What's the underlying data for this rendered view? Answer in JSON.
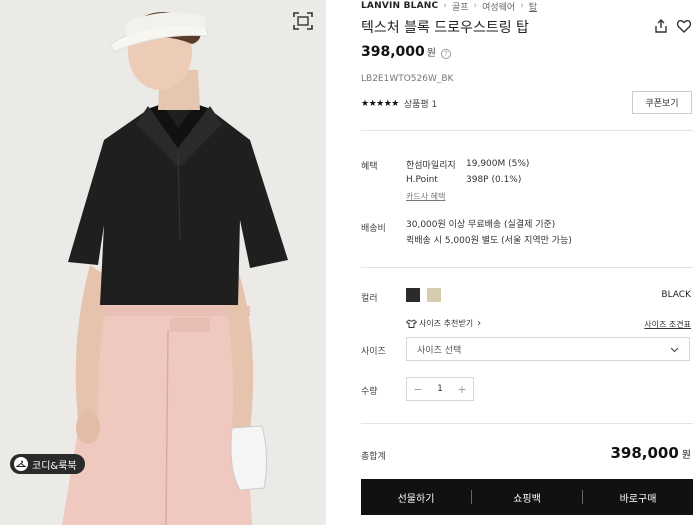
{
  "breadcrumb": {
    "brand": "LANVIN BLANC",
    "items": [
      "골프",
      "여성웨어",
      "탑"
    ]
  },
  "product": {
    "title": "텍스처 블록 드로우스트링 탑",
    "price": "398,000",
    "price_unit": "원",
    "code": "LB2E1WTO526W_BK",
    "stars": "★★★★★",
    "review_label": "상품평 1",
    "coupon_label": "쿠폰보기"
  },
  "benefit": {
    "label": "혜택",
    "rows": [
      {
        "name": "한섬마일리지",
        "value": "19,900M (5%)"
      },
      {
        "name": "H.Point",
        "value": "398P (0.1%)"
      }
    ],
    "card_link": "카드사 혜택"
  },
  "shipping": {
    "label": "배송비",
    "line1": "30,000원 이상 무료배송 (실결제 기준)",
    "line2": "퀵배송 시 5,000원 별도 (서울 지역만 가능)"
  },
  "options": {
    "color_label": "컬러",
    "selected_color": "BLACK",
    "colors": [
      {
        "name": "black",
        "hex": "#2b2b2b"
      },
      {
        "name": "beige",
        "hex": "#d8ccb0"
      }
    ],
    "size_recommend": "사이즈 추천받기",
    "size_guide": "사이즈 조견표",
    "size_label": "사이즈",
    "size_placeholder": "사이즈 선택",
    "quantity_label": "수량",
    "quantity": "1",
    "minus": "−",
    "plus": "+"
  },
  "total": {
    "label": "총합계",
    "price": "398,000",
    "unit": "원"
  },
  "actions": {
    "gift": "선물하기",
    "cart": "쇼핑백",
    "buy": "바로구매"
  },
  "image": {
    "coordi_label": "코디&룩북"
  }
}
